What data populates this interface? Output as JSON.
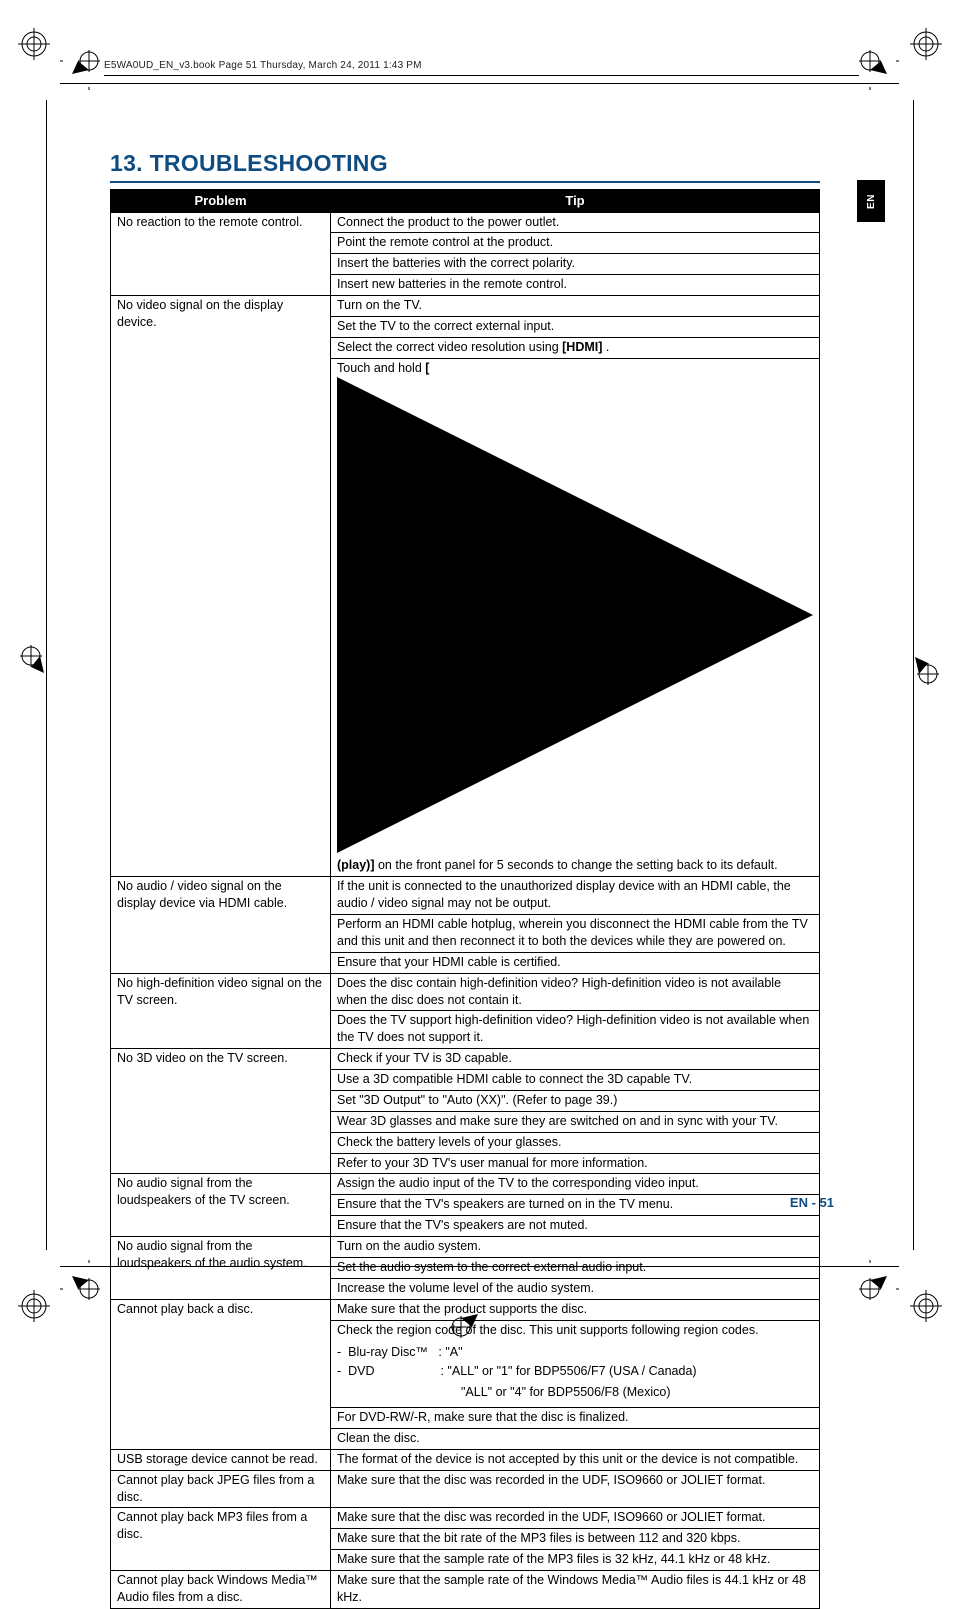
{
  "header_line": "E5WA0UD_EN_v3.book  Page 51  Thursday, March 24, 2011  1:43 PM",
  "heading": "13.  TROUBLESHOOTING",
  "side_tab": "EN",
  "table": {
    "col_problem": "Problem",
    "col_tip": "Tip",
    "rows": [
      {
        "problem": "No reaction to the remote control.",
        "tips": [
          "Connect the product to the power outlet.",
          "Point the remote control at the product.",
          "Insert the batteries with the correct polarity.",
          "Insert new batteries in the remote control."
        ]
      },
      {
        "problem": "No video signal on the display device.",
        "tips": [
          "Turn on the TV.",
          "Set the TV to the correct external input.",
          "Select the correct video resolution using <b>[HDMI]</b> .",
          "Touch and hold <b>[<svg viewBox='0 0 10 10'><polygon points='0,0 10,5 0,10' fill='black'/></svg> (play)]</b> on the front panel for 5 seconds to change the setting back to its default."
        ]
      },
      {
        "problem": "No audio / video signal on the display device via HDMI cable.",
        "tips": [
          "If the unit is connected to the unauthorized display device with an HDMI cable, the audio / video signal may not be output.",
          "Perform an HDMI cable hotplug, wherein you disconnect the HDMI cable from the TV and this unit and then reconnect it to both the devices while they are powered on.",
          "Ensure that your HDMI cable is certified."
        ]
      },
      {
        "problem": "No high-definition video signal on the TV screen.",
        "tips": [
          "Does the disc contain high-definition video? High-definition video is not available when the disc does not contain it.",
          "Does the TV support high-definition video? High-definition video is not available when the TV does not support it."
        ]
      },
      {
        "problem": "No 3D video on the TV screen.",
        "tips": [
          "Check if your TV is 3D capable.",
          "Use a 3D compatible HDMI cable to connect the 3D capable TV.",
          "Set \"3D Output\" to \"Auto (XX)\". (Refer to page 39.)",
          "Wear 3D glasses and make sure they are switched on and in sync with your TV.",
          "Check the battery levels of your glasses.",
          "Refer to your 3D TV's user manual for more information."
        ]
      },
      {
        "problem": "No audio signal from the loudspeakers of the TV screen.",
        "tips": [
          "Assign the audio input of the TV to the corresponding video input.",
          "Ensure that the TV's speakers are turned on in the TV menu.",
          "Ensure that the TV's speakers are not muted."
        ]
      },
      {
        "problem": "No audio signal from the loudspeakers of the audio system.",
        "tips": [
          "Turn on the audio system.",
          "Set the audio system to the correct external audio input.",
          "Increase the volume level of the audio system."
        ]
      },
      {
        "problem": "Cannot play back a disc.",
        "tips": [
          "Make sure that the product supports the disc.",
          "Check the region code of the disc. This unit supports following region codes.<div style='padding:6px 0 2px 0'><span>- &nbsp;Blu-ray Disc™&nbsp;&nbsp; : \"A\"</span></div><div><span>- &nbsp;DVD&nbsp;&nbsp;&nbsp;&nbsp;&nbsp;&nbsp;&nbsp;&nbsp;&nbsp;&nbsp;&nbsp;&nbsp;&nbsp;&nbsp;&nbsp;&nbsp;&nbsp;&nbsp; : \"ALL\" or \"1\" for BDP5506/F7 (USA / Canada)</span></div><div style='padding:4px 0'><span style='margin-left:124px'>\"ALL\" or \"4\" for BDP5506/F8 (Mexico)</span></div>",
          "For DVD-RW/-R, make sure that the disc is finalized.",
          "Clean the disc."
        ]
      },
      {
        "problem": "USB storage device cannot be read.",
        "tips": [
          "The format of the device is not accepted by this unit or the device is not compatible."
        ]
      },
      {
        "problem": "Cannot play back JPEG files from a disc.",
        "tips": [
          "Make sure that the disc was recorded in the UDF, ISO9660 or JOLIET format."
        ]
      },
      {
        "problem": "Cannot play back MP3 files from a disc.",
        "tips": [
          "Make sure that the disc was recorded in the UDF, ISO9660 or JOLIET format.",
          "Make sure that the bit rate of the MP3 files is between 112 and 320 kbps.",
          "Make sure that the sample rate of the MP3 files is 32 kHz, 44.1 kHz or 48 kHz."
        ]
      },
      {
        "problem": "Cannot play back Windows Media™ Audio files from a disc.",
        "tips": [
          "Make sure that the sample rate of the Windows Media™ Audio files is 44.1 kHz or 48 kHz."
        ]
      }
    ]
  },
  "footer": {
    "lang": "EN",
    "sep": " - ",
    "page": "51"
  }
}
